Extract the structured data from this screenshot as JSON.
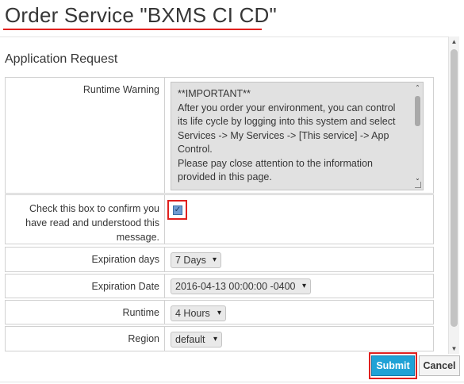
{
  "page": {
    "title": "Order Service \"BXMS CI CD\"",
    "section_title": "Application Request"
  },
  "form": {
    "runtime_warning_label": "Runtime Warning",
    "runtime_warning_text": "**IMPORTANT**\nAfter you order your environment, you can control its life cycle by logging into this system and select Services -> My Services -> [This service] -> App Control.\nPlease pay close attention to the information provided in this page.",
    "confirm_label": "Check this box to confirm you have read and understood this message.",
    "confirm_checked": true,
    "expiration_days_label": "Expiration days",
    "expiration_days_value": "7 Days",
    "expiration_date_label": "Expiration Date",
    "expiration_date_value": "2016-04-13 00:00:00 -0400",
    "runtime_label": "Runtime",
    "runtime_value": "4 Hours",
    "region_label": "Region",
    "region_value": "default"
  },
  "buttons": {
    "submit": "Submit",
    "cancel": "Cancel"
  },
  "colors": {
    "highlight": "#e0201e",
    "submit_bg": "#1fa2d6"
  }
}
